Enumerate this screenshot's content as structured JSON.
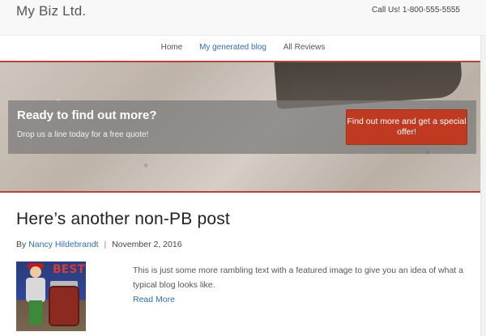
{
  "header": {
    "logo": "My Biz Ltd.",
    "call_us": "Call Us! 1-800-555-5555"
  },
  "nav": {
    "items": [
      {
        "label": "Home",
        "active": false
      },
      {
        "label": "My generated blog",
        "active": true
      },
      {
        "label": "All Reviews",
        "active": false
      }
    ]
  },
  "hero": {
    "title": "Ready to find out more?",
    "subtitle": "Drop us a line today for a free quote!",
    "button_label": "Find out more and get a special offer!"
  },
  "post": {
    "title": "Here’s another non-PB post",
    "by": "By",
    "author": "Nancy Hildebrandt",
    "date": "November 2, 2016",
    "excerpt": "This is just some more rambling text with a featured image to give you an idea of what a typical blog looks like.",
    "read_more": "Read More",
    "thumbnail_text": "BEST"
  },
  "colors": {
    "accent": "#c03a22",
    "link": "#2f6fb0",
    "divider": "#b7443a"
  }
}
